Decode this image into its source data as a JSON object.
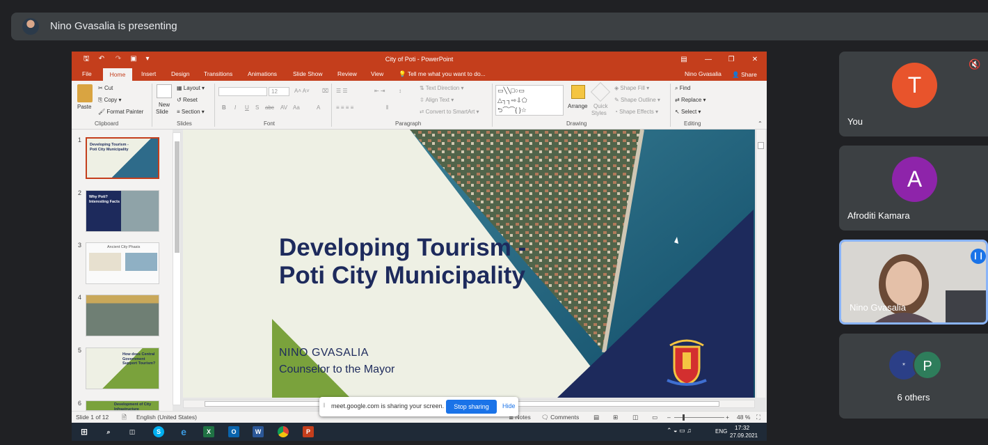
{
  "meet": {
    "presenting_text": "Nino Gvasalia is presenting",
    "share_notification": {
      "text": "meet.google.com is sharing your screen.",
      "stop_label": "Stop sharing",
      "hide_label": "Hide"
    },
    "participants": [
      {
        "name": "You",
        "initial": "T",
        "color": "#e8542c",
        "muted": true
      },
      {
        "name": "Afroditi Kamara",
        "initial": "A",
        "color": "#8e24aa"
      },
      {
        "name": "Nino Gvasalia",
        "speaking": true
      },
      {
        "name": "6 others",
        "initial": "P",
        "color": "#2e7d5b"
      }
    ]
  },
  "ppt": {
    "window_title": "City of Poti - PowerPoint",
    "tabs": [
      "File",
      "Home",
      "Insert",
      "Design",
      "Transitions",
      "Animations",
      "Slide Show",
      "Review",
      "View"
    ],
    "tell_me": "Tell me what you want to do...",
    "user": "Nino Gvasalia",
    "share": "Share",
    "ribbon": {
      "clipboard": {
        "paste": "Paste",
        "cut": "Cut",
        "copy": "Copy",
        "format_painter": "Format Painter",
        "label": "Clipboard"
      },
      "slides": {
        "new_slide": "New",
        "new_slide2": "Slide",
        "layout": "Layout",
        "reset": "Reset",
        "section": "Section",
        "label": "Slides"
      },
      "font": {
        "size": "12",
        "label": "Font"
      },
      "paragraph": {
        "text_direction": "Text Direction",
        "align_text": "Align Text",
        "convert": "Convert to SmartArt",
        "label": "Paragraph"
      },
      "drawing": {
        "arrange": "Arrange",
        "quick_styles": "Quick",
        "quick_styles2": "Styles",
        "shape_fill": "Shape Fill",
        "shape_outline": "Shape Outline",
        "shape_effects": "Shape Effects",
        "label": "Drawing"
      },
      "editing": {
        "find": "Find",
        "replace": "Replace",
        "select": "Select",
        "label": "Editing"
      }
    },
    "slide": {
      "title_line1": "Developing Tourism -",
      "title_line2": "Poti City Municipality",
      "name": "NINO GVASALIA",
      "role": "Counselor to the Mayor"
    },
    "thumbnails": [
      {
        "num": "1",
        "text": "Developing Tourism - Poti City Municipality"
      },
      {
        "num": "2",
        "text": "Why Poti? Interesting Facts"
      },
      {
        "num": "3",
        "text": "Ancient City Phasis"
      },
      {
        "num": "4",
        "text": ""
      },
      {
        "num": "5",
        "text": "How does Central Government Support Tourism?"
      },
      {
        "num": "6",
        "text": "Development of City Infrastructure"
      }
    ],
    "status": {
      "slide_count": "Slide 1 of 12",
      "language": "English (United States)",
      "notes": "Notes",
      "comments": "Comments",
      "zoom": "48 %"
    }
  },
  "taskbar": {
    "lang": "ENG",
    "time": "17:32",
    "date": "27.09.2021"
  }
}
